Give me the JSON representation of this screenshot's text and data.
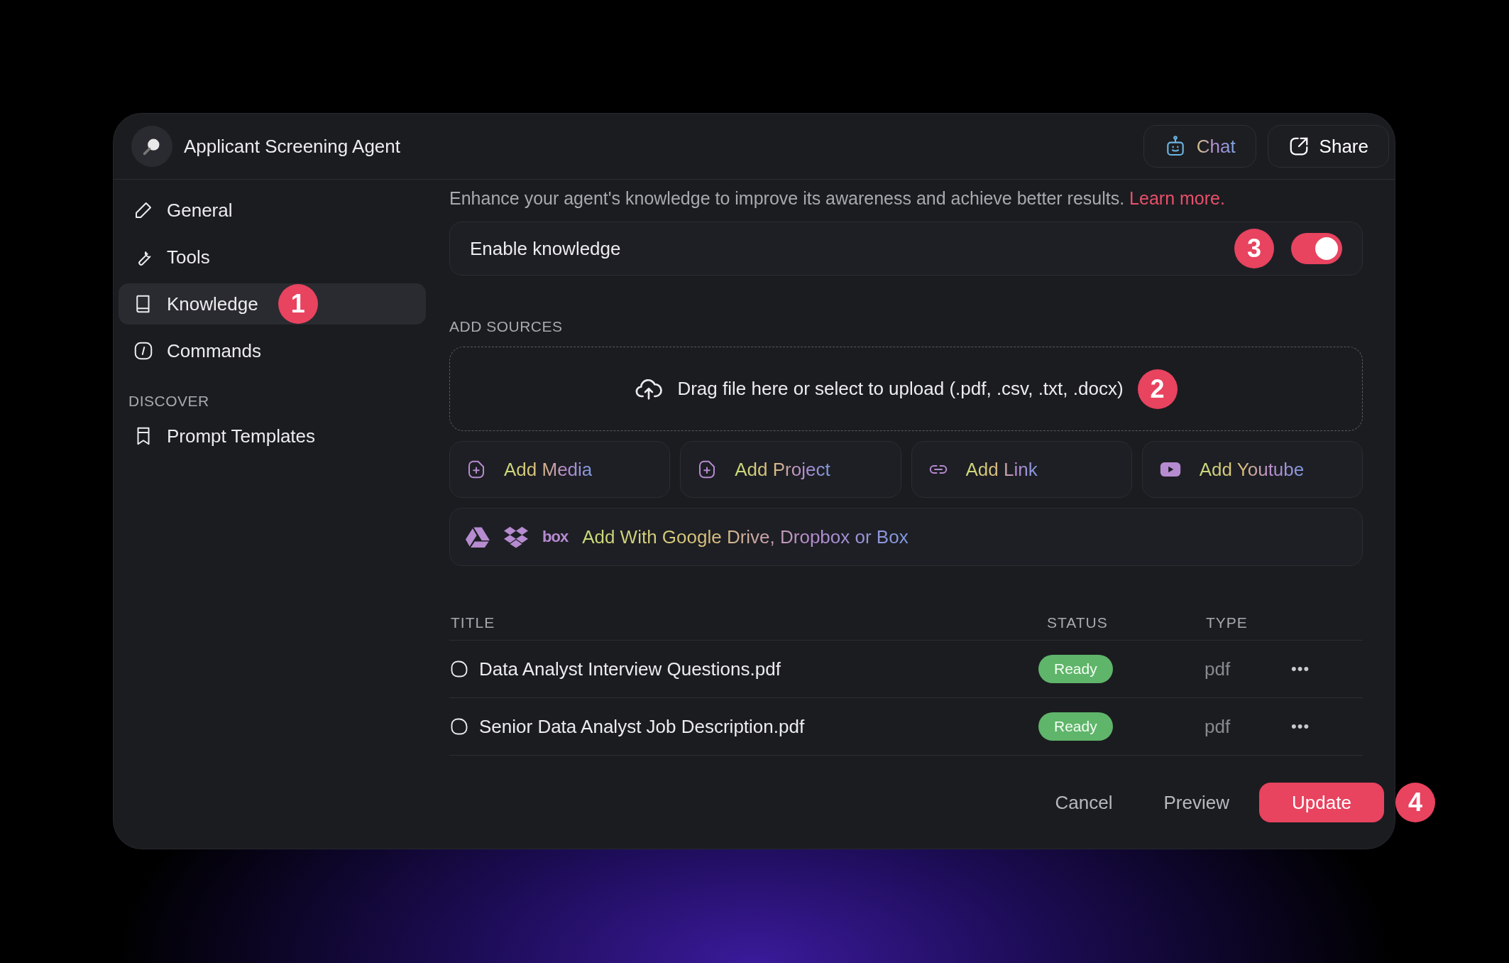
{
  "window": {
    "title": "Applicant Screening Agent"
  },
  "header_buttons": [
    {
      "label": "Chat",
      "kind": "chat"
    },
    {
      "label": "Share",
      "kind": "share"
    }
  ],
  "sidebar": {
    "groups": [
      {
        "items": [
          {
            "label": "General",
            "kind": "pencil",
            "selected": false
          },
          {
            "label": "Tools",
            "kind": "wrench",
            "selected": false
          },
          {
            "label": "Knowledge",
            "kind": "book",
            "selected": true,
            "badge": "1"
          },
          {
            "label": "Commands",
            "kind": "slash",
            "selected": false
          }
        ]
      },
      {
        "heading": "DISCOVER",
        "items": [
          {
            "label": "Prompt Templates",
            "kind": "bookmark",
            "selected": false
          }
        ]
      }
    ]
  },
  "description": {
    "text": "Enhance your agent's knowledge to improve its awareness and achieve better results.",
    "link": "Learn more."
  },
  "enable_knowledge": {
    "label": "Enable knowledge",
    "on": true,
    "badge": "3"
  },
  "add_sources": {
    "heading": "ADD SOURCES",
    "upload": {
      "text": "Drag file here or select to upload (.pdf, .csv, .txt, .docx)",
      "badge": "2"
    },
    "buttons": [
      {
        "label": "Add Media",
        "kind": "file-plus"
      },
      {
        "label": "Add Project",
        "kind": "file-plus"
      },
      {
        "label": "Add Link",
        "kind": "link"
      },
      {
        "label": "Add Youtube",
        "kind": "video"
      }
    ],
    "cloud": {
      "box_logo": "box",
      "text": "Add With Google Drive, Dropbox or Box"
    }
  },
  "table": {
    "columns": [
      "TITLE",
      "STATUS",
      "TYPE"
    ],
    "rows": [
      {
        "title": "Data Analyst Interview Questions.pdf",
        "status": "Ready",
        "type": "pdf",
        "menu": "•••"
      },
      {
        "title": "Senior Data Analyst Job Description.pdf",
        "status": "Ready",
        "type": "pdf",
        "menu": "•••"
      }
    ]
  },
  "footer": {
    "buttons": [
      {
        "label": "Cancel",
        "kind": "plain"
      },
      {
        "label": "Preview",
        "kind": "plain"
      },
      {
        "label": "Update",
        "kind": "primary",
        "badge": "4"
      }
    ]
  }
}
